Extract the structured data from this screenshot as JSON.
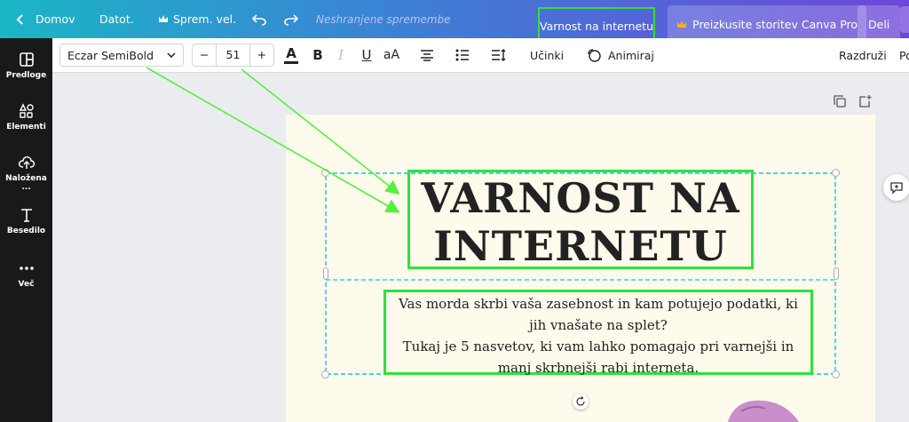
{
  "topbar": {
    "home": "Domov",
    "file": "Datot.",
    "resize": "Sprem. vel.",
    "unsaved": "Neshranjene spremembe",
    "doc_title": "Varnost na internetu",
    "pro_button": "Preizkusite storitev Canva Pro",
    "share_button": "Deli"
  },
  "sidebar": {
    "items": [
      {
        "label": "Predloge",
        "icon": "templates-icon"
      },
      {
        "label": "Elementi",
        "icon": "elements-icon"
      },
      {
        "label": "Naložena ...",
        "icon": "upload-icon"
      },
      {
        "label": "Besedilo",
        "icon": "text-icon"
      },
      {
        "label": "Več",
        "icon": "more-icon"
      }
    ]
  },
  "toolbar": {
    "font_family": "Eczar SemiBold",
    "font_size": "51",
    "minus": "−",
    "plus": "+",
    "text_color_glyph": "A",
    "bold_glyph": "B",
    "italic_glyph": "I",
    "underline_glyph": "U",
    "case_glyph": "aA",
    "effects": "Učinki",
    "animate": "Animiraj",
    "ungroup": "Razdruži",
    "position_partial": "Po"
  },
  "design": {
    "heading_line1": "VARNOST NA",
    "heading_line2": "INTERNETU",
    "body_line1": "Vas morda skrbi vaša zasebnost in kam potujejo podatki, ki",
    "body_line2": "jih vnašate na splet?",
    "body_line3": "Tukaj je 5 nasvetov, ki vam lahko pomagajo pri varnejši in",
    "body_line4": "manj skrbnejši rabi interneta."
  },
  "colors": {
    "highlight": "#2ee23a",
    "annotation_arrow": "#55f03c",
    "selection": "#13c4e0",
    "sidebar_bg": "#18191b",
    "page_bg": "#fefaec"
  }
}
